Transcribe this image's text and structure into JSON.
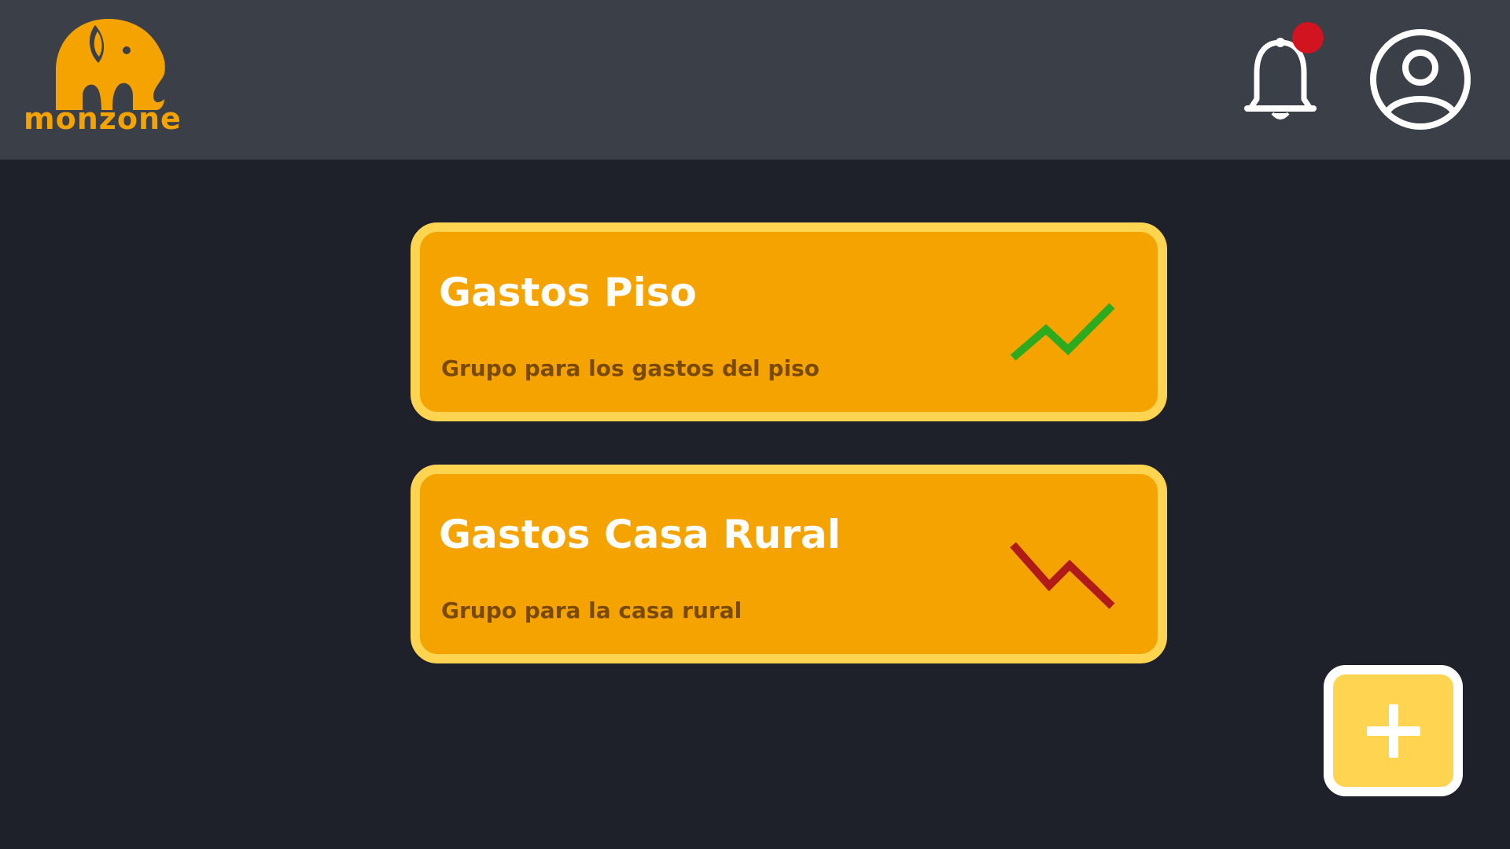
{
  "app": {
    "logo_text": "monzone",
    "brand_color": "#f4a300",
    "accent_light": "#ffd451"
  },
  "header": {
    "notification_icon": "bell-icon",
    "has_unread_notifications": true,
    "profile_icon": "user-circle-icon"
  },
  "groups": [
    {
      "title": "Gastos Piso",
      "description": "Grupo para los gastos del piso",
      "trend": "up",
      "trend_icon": "trend-up-icon",
      "trend_color": "#2eaa1f"
    },
    {
      "title": "Gastos Casa Rural",
      "description": "Grupo para la casa rural",
      "trend": "down",
      "trend_icon": "trend-down-icon",
      "trend_color": "#b01b18"
    }
  ],
  "fab": {
    "icon": "plus-icon"
  }
}
